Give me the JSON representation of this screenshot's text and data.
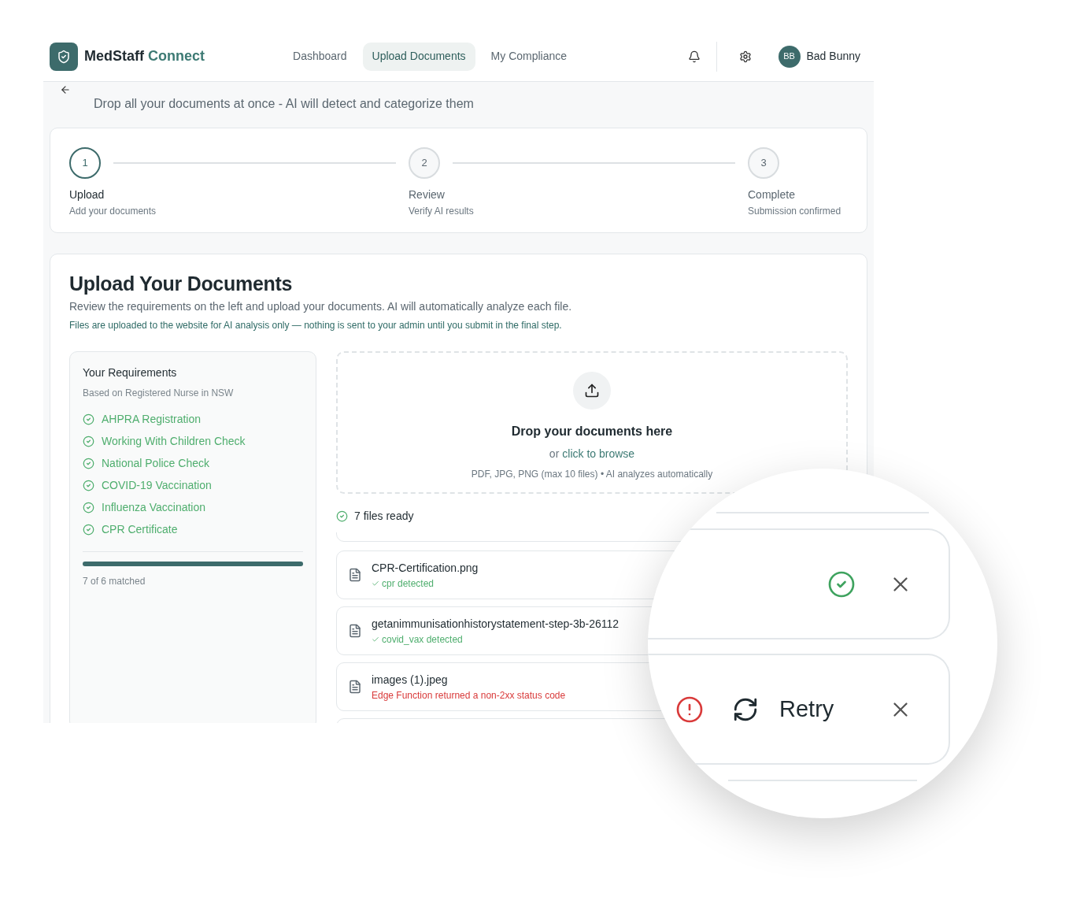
{
  "brand": {
    "name": "MedStaff",
    "accent": "Connect"
  },
  "nav": [
    {
      "label": "Dashboard",
      "selected": false
    },
    {
      "label": "Upload Documents",
      "selected": true
    },
    {
      "label": "My Compliance",
      "selected": false
    }
  ],
  "user": {
    "initials": "BB",
    "name": "Bad Bunny"
  },
  "subtitle": "Drop all your documents at once - AI will detect and categorize them",
  "steps": [
    {
      "number": "1",
      "label": "Upload",
      "description": "Add your documents",
      "selected": true
    },
    {
      "number": "2",
      "label": "Review",
      "description": "Verify AI results",
      "selected": false
    },
    {
      "number": "3",
      "label": "Complete",
      "description": "Submission confirmed",
      "selected": false
    }
  ],
  "upload": {
    "title": "Upload Your Documents",
    "description": "Review the requirements on the left and upload your documents. AI will automatically analyze each file.",
    "note": "Files are uploaded to the website for AI analysis only — nothing is sent to your admin until you submit in the final step."
  },
  "requirements": {
    "title": "Your Requirements",
    "subtitle": "Based on Registered Nurse in NSW",
    "items": [
      {
        "label": "AHPRA Registration",
        "met": true
      },
      {
        "label": "Working With Children Check",
        "met": true
      },
      {
        "label": "National Police Check",
        "met": true
      },
      {
        "label": "COVID-19 Vaccination",
        "met": true
      },
      {
        "label": "Influenza Vaccination",
        "met": true
      },
      {
        "label": "CPR Certificate",
        "met": true
      }
    ],
    "level": 1.0,
    "summary": "7 of 6 matched"
  },
  "dropzone": {
    "title": "Drop your documents here",
    "prefix": "or",
    "link": "click to browse",
    "hint": "PDF, JPG, PNG (max 10 files) • AI analyzes automatically"
  },
  "files_ready": "7 files ready",
  "files": [
    {
      "name": "CPR-Certification.png",
      "kind": "detected",
      "message": "cpr detected"
    },
    {
      "name": "getanimmunisationhistorystatement-step-3b-26112",
      "kind": "detected",
      "message": "covid_vax detected"
    },
    {
      "name": "images (1).jpeg",
      "kind": "error",
      "message": "Edge Function returned a non-2xx status code"
    }
  ],
  "magnifier": {
    "rows": [
      {
        "kind": "success"
      },
      {
        "kind": "error",
        "action": "Retry"
      }
    ]
  }
}
